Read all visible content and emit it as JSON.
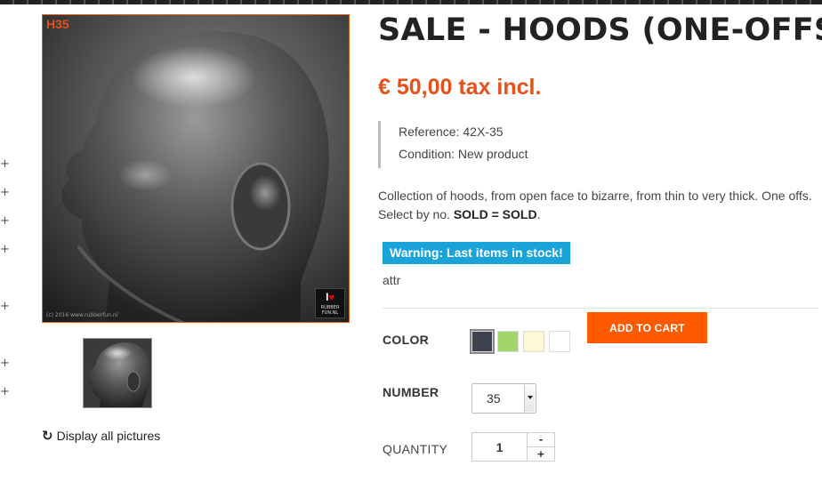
{
  "sidebar": {
    "plus_symbols": [
      "+",
      "+",
      "+",
      "+",
      "+",
      "+",
      "+"
    ]
  },
  "gallery": {
    "main_image_tag": "H35",
    "logo_letter": "I",
    "logo_heart": "♥",
    "logo_brand_1": "RUBBER",
    "logo_brand_2": "FUN.NL",
    "copyright": "(c) 2016 www.rubberfun.nl",
    "display_all_icon": "↻",
    "display_all_label": "Display all pictures"
  },
  "product": {
    "title": "SALE - HOODS (ONE-OFFS)",
    "price": "€ 50,00 tax incl.",
    "reference": "Reference: 42X-35",
    "condition": "Condition: New product",
    "description_text": "Collection of hoods, from open face to bizarre, from thin to very thick. One offs. Select by no. ",
    "description_bold": "SOLD = SOLD",
    "description_end": ".",
    "stock_warning": "Warning: Last items in stock!",
    "attr_label": "attr"
  },
  "options": {
    "color_label": "COLOR",
    "colors": [
      {
        "name": "dark-grey",
        "hex": "#3d4450"
      },
      {
        "name": "light-green",
        "hex": "#9fd56b"
      },
      {
        "name": "cream",
        "hex": "#fdf8d6"
      },
      {
        "name": "white",
        "hex": "#ffffff"
      }
    ],
    "selected_color_index": 0,
    "number_label": "NUMBER",
    "number_value": "35",
    "quantity_label": "QUANTITY",
    "quantity_value": "1",
    "quantity_minus": "-",
    "quantity_plus": "+"
  },
  "cart": {
    "add_to_cart_label": "ADD TO CART"
  },
  "colors": {
    "accent": "#e8501a",
    "button": "#ff5a00",
    "warning_bg": "#1aa3d8"
  }
}
